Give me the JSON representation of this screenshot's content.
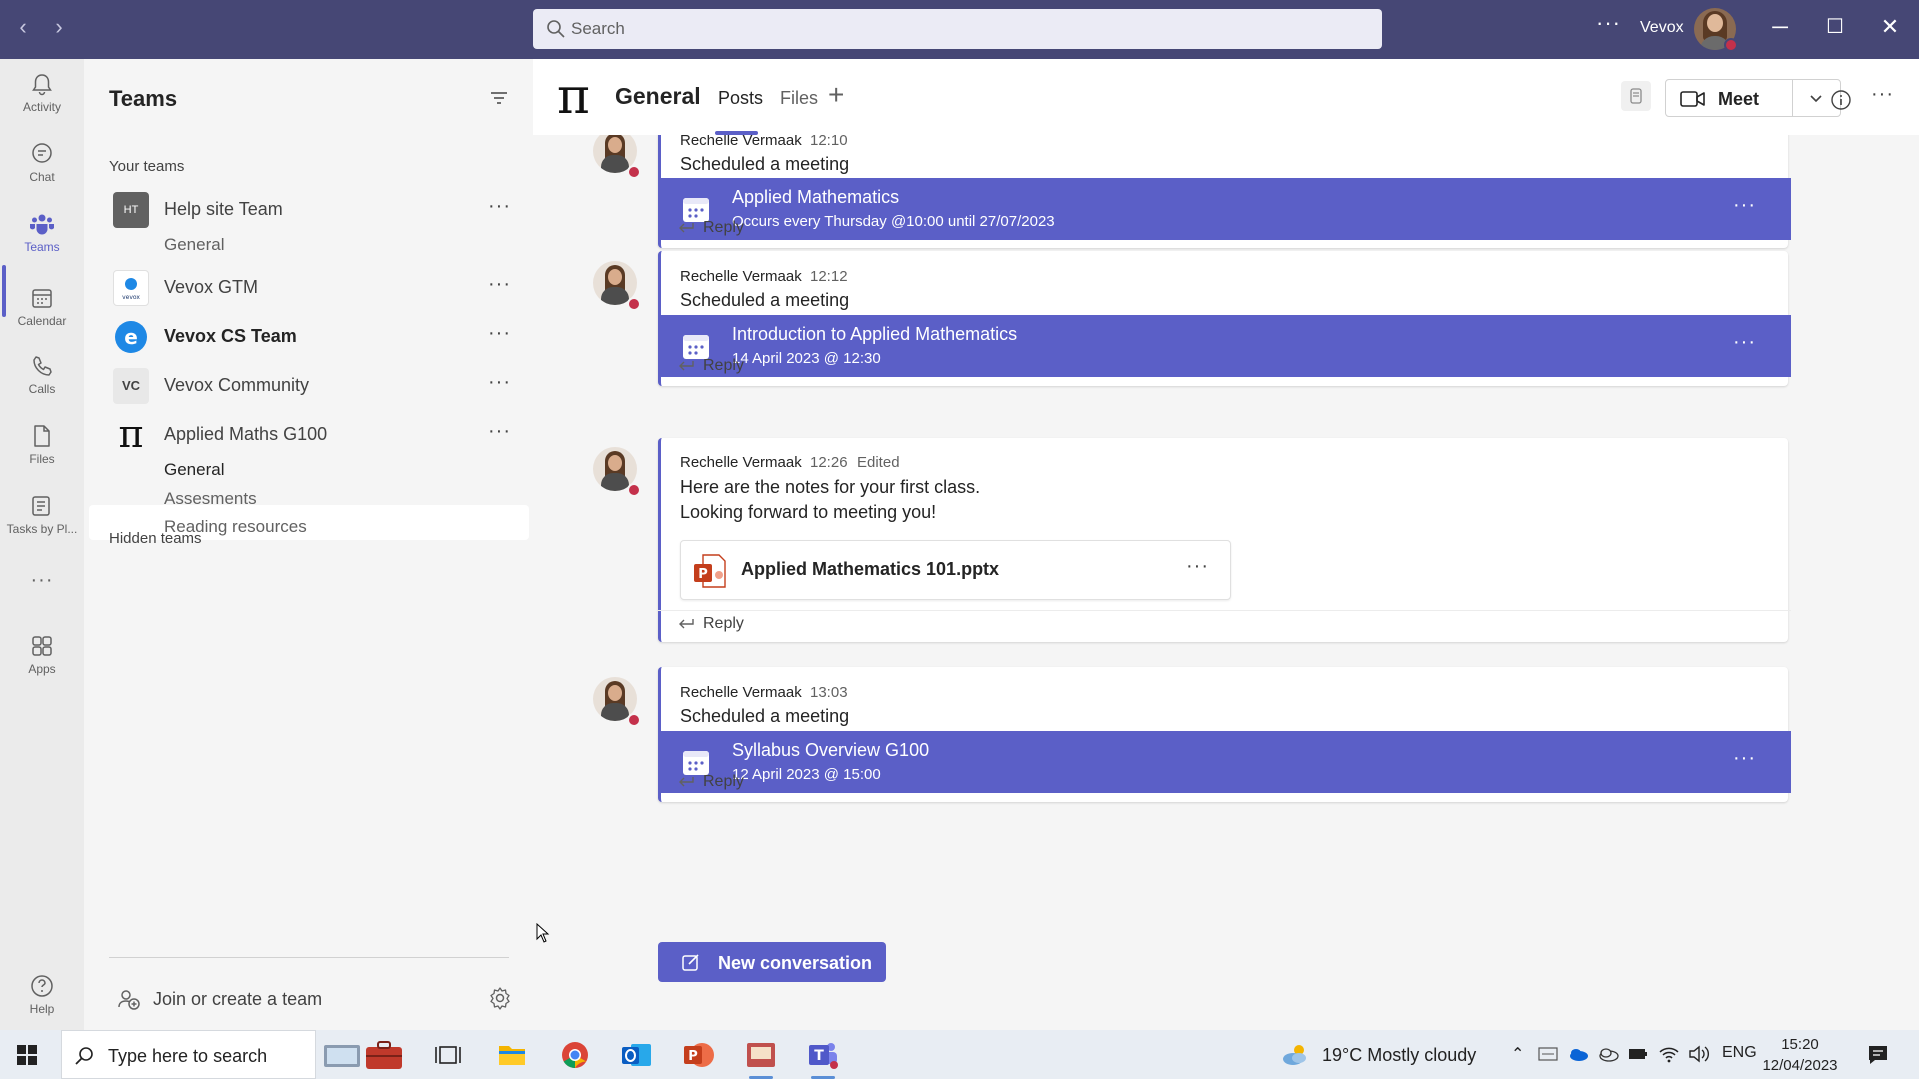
{
  "titlebar": {
    "search_placeholder": "Search",
    "user_name": "Vevox",
    "bg_color": "#464775"
  },
  "rail": {
    "items": [
      {
        "label": "Activity",
        "icon": "bell-icon"
      },
      {
        "label": "Chat",
        "icon": "chat-icon"
      },
      {
        "label": "Teams",
        "icon": "teams-icon",
        "active": true
      },
      {
        "label": "Calendar",
        "icon": "calendar-icon"
      },
      {
        "label": "Calls",
        "icon": "phone-icon"
      },
      {
        "label": "Files",
        "icon": "file-icon"
      },
      {
        "label": "Tasks by Pl...",
        "icon": "tasks-icon"
      },
      {
        "label": "Apps",
        "icon": "apps-icon"
      },
      {
        "label": "Help",
        "icon": "help-icon"
      }
    ]
  },
  "teams_panel": {
    "title": "Teams",
    "your_teams_label": "Your teams",
    "hidden_teams_label": "Hidden teams",
    "teams": [
      {
        "name": "Help site Team",
        "avatar": "HT",
        "channels": [
          "General"
        ]
      },
      {
        "name": "Vevox GTM",
        "avatar": "vevox"
      },
      {
        "name": "Vevox CS Team",
        "avatar": "e",
        "bold": true
      },
      {
        "name": "Vevox Community",
        "avatar": "VC"
      },
      {
        "name": "Applied Maths G100",
        "avatar": "π",
        "channels": [
          "General",
          "Assesments",
          "Reading resources"
        ],
        "active_channel": "General"
      }
    ],
    "join_label": "Join or create a team"
  },
  "channel_header": {
    "title": "General",
    "tabs": [
      "Posts",
      "Files"
    ],
    "active_tab": "Posts",
    "meet_label": "Meet"
  },
  "posts": [
    {
      "author": "Rechelle Vermaak",
      "time": "12:10",
      "text": "Scheduled a meeting",
      "meeting": {
        "title": "Applied Mathematics",
        "subtitle": "Occurs every Thursday @10:00 until 27/07/2023"
      },
      "reply_label": "Reply"
    },
    {
      "author": "Rechelle Vermaak",
      "time": "12:12",
      "text": "Scheduled a meeting",
      "meeting": {
        "title": "Introduction to Applied Mathematics",
        "subtitle": "14 April 2023 @ 12:30"
      },
      "reply_label": "Reply"
    },
    {
      "author": "Rechelle Vermaak",
      "time": "12:26",
      "edited": "Edited",
      "text_lines": [
        "Here are the notes for your first class.",
        "Looking forward to meeting you!"
      ],
      "attachment": "Applied Mathematics 101.pptx",
      "reply_label": "Reply"
    },
    {
      "author": "Rechelle Vermaak",
      "time": "13:03",
      "text": "Scheduled a meeting",
      "meeting": {
        "title": "Syllabus Overview G100",
        "subtitle": "12 April 2023 @ 15:00"
      },
      "reply_label": "Reply"
    }
  ],
  "new_conversation_label": "New conversation",
  "taskbar": {
    "search_placeholder": "Type here to search",
    "weather": "19°C  Mostly cloudy",
    "language": "ENG",
    "time": "15:20",
    "date": "12/04/2023"
  },
  "colors": {
    "accent": "#5b5fc7",
    "presence_busy": "#c4314b"
  }
}
